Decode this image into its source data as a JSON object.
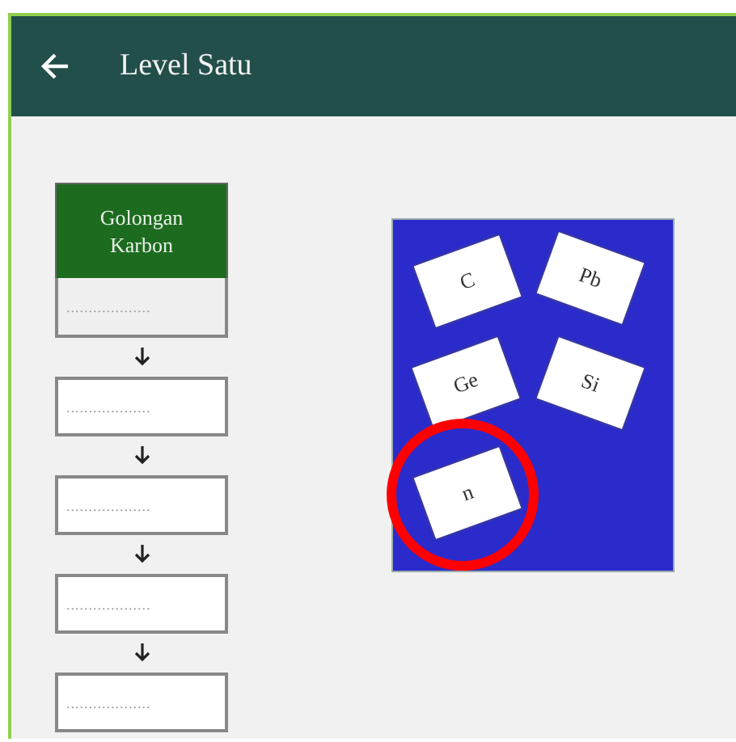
{
  "app_bar": {
    "title": "Level Satu"
  },
  "flow": {
    "header": "Golongan Karbon",
    "slots": [
      {
        "placeholder": "..................."
      },
      {
        "placeholder": "..................."
      },
      {
        "placeholder": "..................."
      },
      {
        "placeholder": "..................."
      },
      {
        "placeholder": "..................."
      }
    ]
  },
  "cards": [
    {
      "label": "C",
      "highlighted": false
    },
    {
      "label": "Pb",
      "highlighted": false
    },
    {
      "label": "Ge",
      "highlighted": false
    },
    {
      "label": "Si",
      "highlighted": false
    },
    {
      "label": "n",
      "highlighted": true
    }
  ]
}
